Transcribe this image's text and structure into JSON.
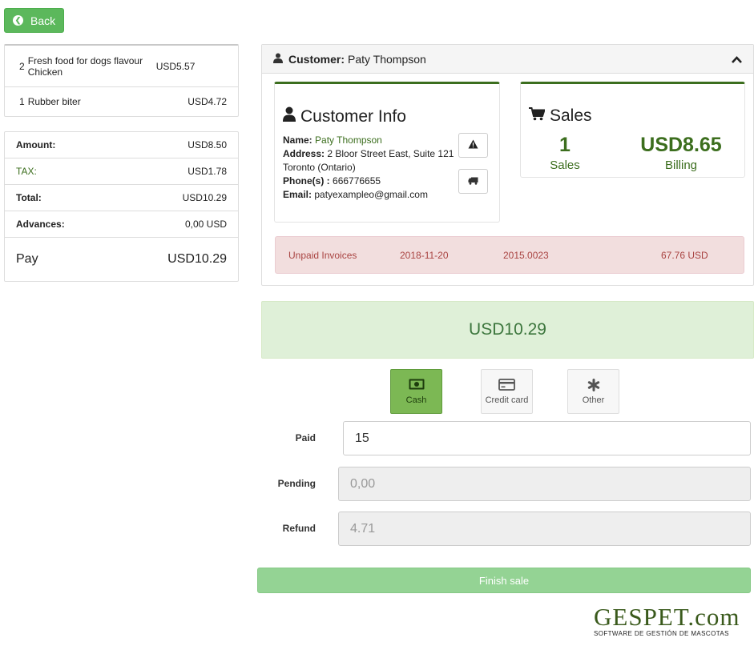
{
  "nav": {
    "back_label": "Back"
  },
  "cart": {
    "items": [
      {
        "qty": "2",
        "name": "Fresh food for dogs flavour Chicken",
        "price": "USD5.57"
      },
      {
        "qty": "1",
        "name": "Rubber biter",
        "price": "USD4.72"
      }
    ]
  },
  "totals": {
    "amount_label": "Amount:",
    "amount": "USD8.50",
    "tax_label": "TAX:",
    "tax": "USD1.78",
    "total_label": "Total:",
    "total": "USD10.29",
    "advances_label": "Advances:",
    "advances": "0,00 USD",
    "pay_label": "Pay",
    "pay": "USD10.29"
  },
  "customer": {
    "header_label": "Customer:",
    "header_name": "Paty Thompson",
    "info_title": "Customer Info",
    "name_label": "Name:",
    "name": "Paty Thompson",
    "address_label": "Address:",
    "address_line1": "2 Bloor Street East, Suite 121",
    "address_line2": "Toronto (Ontario)",
    "phone_label": "Phone(s) :",
    "phone": "666776655",
    "email_label": "Email:",
    "email": "patyexampleo@gmail.com"
  },
  "sales": {
    "title": "Sales",
    "count": "1",
    "count_label": "Sales",
    "billing": "USD8.65",
    "billing_label": "Billing"
  },
  "unpaid": {
    "label": "Unpaid Invoices",
    "date": "2018-11-20",
    "number": "2015.0023",
    "amount": "67.76 USD"
  },
  "payment": {
    "total": "USD10.29",
    "methods": [
      {
        "label": "Cash",
        "icon": "cash-icon",
        "active": true
      },
      {
        "label": "Credit card",
        "icon": "credit-card-icon",
        "active": false
      },
      {
        "label": "Other",
        "icon": "asterisk-icon",
        "active": false
      }
    ],
    "paid_label": "Paid",
    "paid_value": "15",
    "pending_label": "Pending",
    "pending_value": "0,00",
    "refund_label": "Refund",
    "refund_value": "4.71",
    "finish_label": "Finish sale"
  },
  "logo": {
    "main": "GESPET.com",
    "tagline": "SOFTWARE DE GESTIÓN DE MASCOTAS"
  },
  "colors": {
    "brand_green": "#3c6e1e",
    "success_button": "#5cb85c",
    "danger_bg": "#f2dede",
    "active_method": "#7cb854",
    "finish_button": "#94d394"
  }
}
